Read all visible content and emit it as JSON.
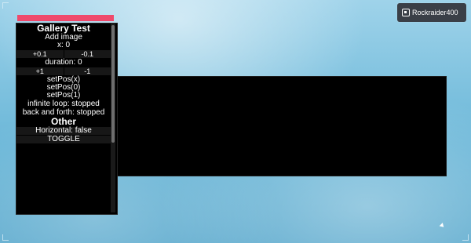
{
  "account": {
    "username": "Rockraider400"
  },
  "panel": {
    "title": "Gallery Test",
    "add_image": "Add image",
    "x_value": "x: 0",
    "x_inc": "+0.1",
    "x_dec": "-0.1",
    "duration": "duration: 0",
    "dur_inc": "+1",
    "dur_dec": "-1",
    "setpos_x": "setPos(x)",
    "setpos_0": "setPos(0)",
    "setpos_1": "setPos(1)",
    "infinite_loop": "infinite loop: stopped",
    "back_forth": "back and forth: stopped",
    "other_title": "Other",
    "horizontal": "Horizontal: false",
    "toggle": "TOGGLE"
  },
  "colors": {
    "accent_bar": "#ef4a6c",
    "panel_bg": "#000000",
    "badge_bg": "#3a3f47"
  },
  "icons": {
    "badge_icon": "roblox-account-icon",
    "cursor": "mouse-cursor-icon"
  }
}
